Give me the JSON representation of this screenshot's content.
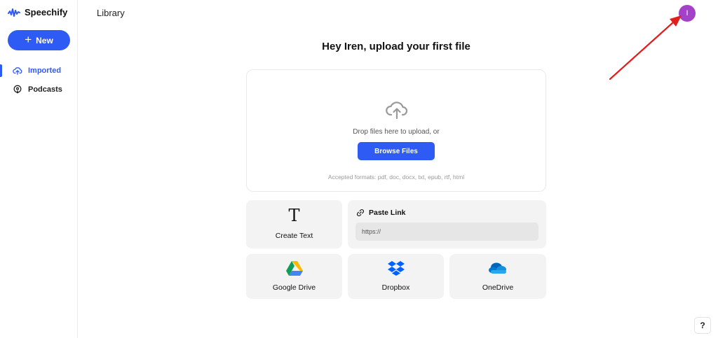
{
  "app": {
    "name": "Speechify"
  },
  "sidebar": {
    "new_label": "New",
    "items": [
      {
        "label": "Imported",
        "icon": "cloud-upload-icon",
        "active": true
      },
      {
        "label": "Podcasts",
        "icon": "podcast-icon",
        "active": false
      }
    ]
  },
  "header": {
    "title": "Library",
    "avatar_initial": "I"
  },
  "main": {
    "heading": "Hey Iren, upload your first file",
    "dropzone": {
      "text": "Drop files here to upload, or",
      "browse_label": "Browse Files",
      "formats": "Accepted formats: pdf, doc, docx, txt, epub, rtf, html"
    },
    "create_text": {
      "icon_glyph": "T",
      "label": "Create Text"
    },
    "paste_link": {
      "label": "Paste Link",
      "placeholder": "https://"
    },
    "services": [
      {
        "label": "Google Drive",
        "icon": "google-drive-icon"
      },
      {
        "label": "Dropbox",
        "icon": "dropbox-icon"
      },
      {
        "label": "OneDrive",
        "icon": "onedrive-icon"
      }
    ]
  },
  "help": {
    "label": "?"
  },
  "colors": {
    "accent": "#2f5bf5",
    "avatar": "#a441c9",
    "annotation_arrow": "#e01e1e",
    "card": "#f3f3f3"
  }
}
